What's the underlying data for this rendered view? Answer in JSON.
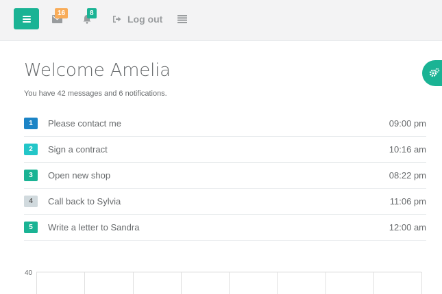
{
  "topbar": {
    "mail_badge": "16",
    "notifications_badge": "8",
    "logout_label": "Log out"
  },
  "main": {
    "title": "Welcome Amelia",
    "subtitle": "You have 42 messages and 6 notifications."
  },
  "tasks": [
    {
      "num": "1",
      "label": "Please contact me",
      "time": "09:00 pm",
      "color": "#1c84c6"
    },
    {
      "num": "2",
      "label": "Sign a contract",
      "time": "10:16 am",
      "color": "#23c6c8"
    },
    {
      "num": "3",
      "label": "Open new shop",
      "time": "08:22 pm",
      "color": "#1ab394"
    },
    {
      "num": "4",
      "label": "Call back to Sylvia",
      "time": "11:06 pm",
      "color": "#d1dade"
    },
    {
      "num": "5",
      "label": "Write a letter to Sandra",
      "time": "12:00 am",
      "color": "#1ab394"
    }
  ],
  "chart_data": {
    "type": "line",
    "y_tick_labels": [
      "40"
    ]
  },
  "colors": {
    "accent": "#1ab394",
    "badge_orange": "#f8ac59"
  }
}
